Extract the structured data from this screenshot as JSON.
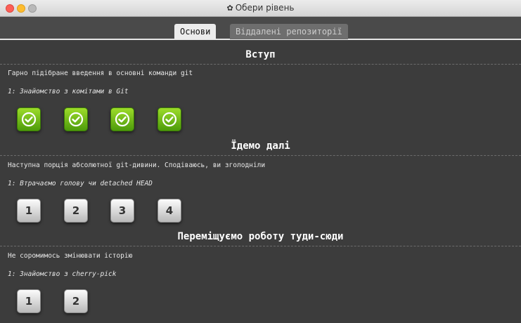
{
  "window": {
    "title": "Обери рівень"
  },
  "tabs": [
    {
      "label": "Основи",
      "active": true
    },
    {
      "label": "Віддалені репозиторії",
      "active": false
    }
  ],
  "sections": [
    {
      "title": "Вступ",
      "about": "Гарно підібране введення в основні команди git",
      "sequence": "1: Знайомство з комітами в Git",
      "levels": [
        {
          "label": "",
          "solved": true
        },
        {
          "label": "",
          "solved": true
        },
        {
          "label": "",
          "solved": true
        },
        {
          "label": "",
          "solved": true
        }
      ]
    },
    {
      "title": "Їдемо далі",
      "about": "Наступна порція абсолютної git-дивини. Сподіваюсь, ви зголодніли",
      "sequence": "1: Втрачаємо голову чи detached HEAD",
      "levels": [
        {
          "label": "1",
          "solved": false
        },
        {
          "label": "2",
          "solved": false
        },
        {
          "label": "3",
          "solved": false
        },
        {
          "label": "4",
          "solved": false
        }
      ]
    },
    {
      "title": "Переміщуємо роботу туди-сюди",
      "about": "Не соромимось змінювати історію",
      "sequence": "1: Знайомство з cherry-pick",
      "levels": [
        {
          "label": "1",
          "solved": false
        },
        {
          "label": "2",
          "solved": false
        }
      ]
    }
  ],
  "colors": {
    "background": "#3c3c3c",
    "solved": "#6ab915",
    "open": "#e6e6e6"
  }
}
